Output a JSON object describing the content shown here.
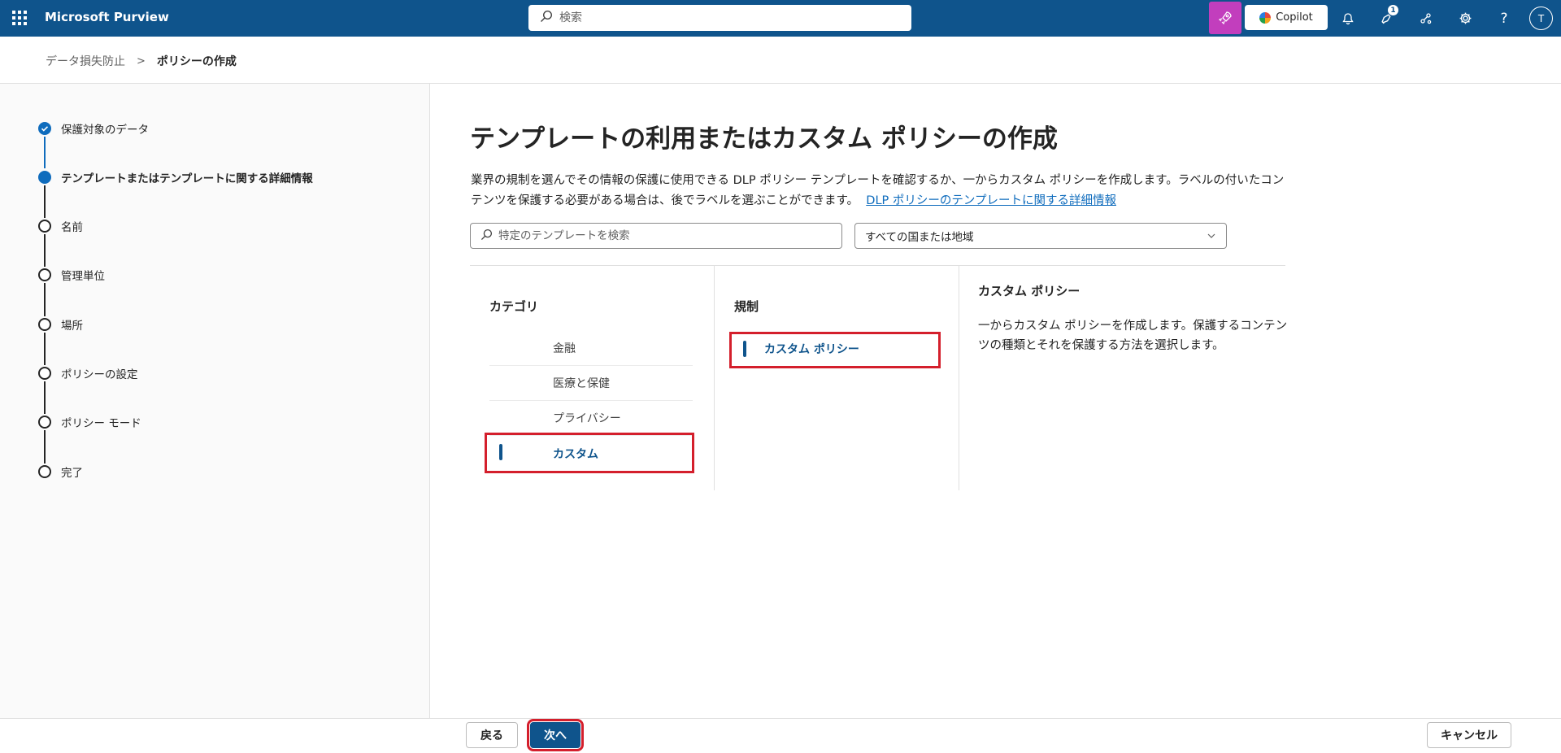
{
  "app": {
    "title": "Microsoft Purview"
  },
  "topbar": {
    "search_placeholder": "検索",
    "copilot_label": "Copilot",
    "notification_count": "1",
    "avatar_initial": "T"
  },
  "breadcrumb": {
    "parent": "データ損失防止",
    "current": "ポリシーの作成"
  },
  "steps": [
    {
      "label": "保護対象のデータ",
      "state": "done"
    },
    {
      "label": "テンプレートまたはテンプレートに関する詳細情報",
      "state": "current"
    },
    {
      "label": "名前",
      "state": "pending"
    },
    {
      "label": "管理単位",
      "state": "pending"
    },
    {
      "label": "場所",
      "state": "pending"
    },
    {
      "label": "ポリシーの設定",
      "state": "pending"
    },
    {
      "label": "ポリシー モード",
      "state": "pending"
    },
    {
      "label": "完了",
      "state": "pending"
    }
  ],
  "main": {
    "title": "テンプレートの利用またはカスタム ポリシーの作成",
    "description": "業界の規制を選んでその情報の保護に使用できる DLP ポリシー テンプレートを確認するか、一からカスタム ポリシーを作成します。ラベルの付いたコンテンツを保護する必要がある場合は、後でラベルを選ぶことができます。",
    "learn_more_link": "DLP ポリシーのテンプレートに関する詳細情報",
    "template_search_placeholder": "特定のテンプレートを検索",
    "region_selected": "すべての国または地域"
  },
  "categories": {
    "header": "カテゴリ",
    "items": [
      "金融",
      "医療と保健",
      "プライバシー",
      "カスタム"
    ],
    "selected": "カスタム"
  },
  "regulations": {
    "header": "規制",
    "items": [
      "カスタム ポリシー"
    ],
    "selected": "カスタム ポリシー"
  },
  "detail": {
    "title": "カスタム ポリシー",
    "text": "一からカスタム ポリシーを作成します。保護するコンテンツの種類とそれを保護する方法を選択します。"
  },
  "footer": {
    "back_label": "戻る",
    "next_label": "次へ",
    "cancel_label": "キャンセル"
  },
  "colors": {
    "topbar": "#0f548c",
    "accent": "#0f6cbd",
    "highlight": "#d41f2c",
    "copilot_button": "#c23ebd"
  }
}
